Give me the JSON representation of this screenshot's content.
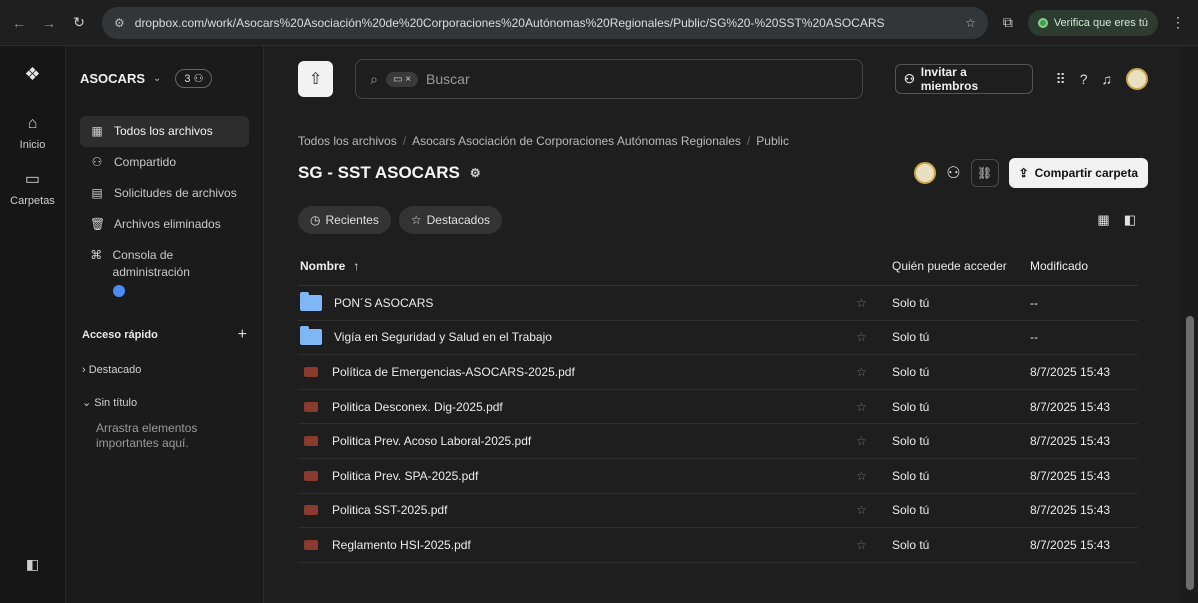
{
  "browser": {
    "url": "dropbox.com/work/Asocars%20Asociación%20de%20Corporaciones%20Autónomas%20Regionales/Public/SG%20-%20SST%20ASOCARS",
    "verify_label": "Verifica que eres tú"
  },
  "rail": {
    "items": [
      {
        "label": "Inicio"
      },
      {
        "label": "Carpetas"
      }
    ]
  },
  "sidebar": {
    "team_name": "ASOCARS",
    "member_count": "3",
    "nav": [
      {
        "label": "Todos los archivos"
      },
      {
        "label": "Compartido"
      },
      {
        "label": "Solicitudes de archivos"
      },
      {
        "label": "Archivos eliminados"
      },
      {
        "label": "Consola de administración"
      }
    ],
    "quick_access_title": "Acceso rápido",
    "quick_items": [
      "Destacado",
      "Sin título"
    ],
    "drag_hint": "Arrastra elementos importantes aquí."
  },
  "topbar": {
    "search_placeholder": "Buscar",
    "invite_label": "Invitar a miembros"
  },
  "breadcrumb": [
    "Todos los archivos",
    "Asocars Asociación de Corporaciones Autónomas Regionales",
    "Public"
  ],
  "folder": {
    "title": "SG - SST ASOCARS",
    "share_label": "Compartir carpeta"
  },
  "filters": {
    "recent": "Recientes",
    "starred": "Destacados"
  },
  "table": {
    "headers": {
      "name": "Nombre",
      "who": "Quién puede acceder",
      "modified": "Modificado"
    },
    "rows": [
      {
        "type": "folder",
        "name": "PON´S ASOCARS",
        "who": "Solo tú",
        "modified": "--"
      },
      {
        "type": "folder",
        "name": "Vigía en Seguridad y Salud en el Trabajo",
        "who": "Solo tú",
        "modified": "--"
      },
      {
        "type": "pdf",
        "name": "Política de Emergencias-ASOCARS-2025.pdf",
        "who": "Solo tú",
        "modified": "8/7/2025 15:43"
      },
      {
        "type": "pdf",
        "name": "Politica Desconex. Dig-2025.pdf",
        "who": "Solo tú",
        "modified": "8/7/2025 15:43"
      },
      {
        "type": "pdf",
        "name": "Politica Prev. Acoso Laboral-2025.pdf",
        "who": "Solo tú",
        "modified": "8/7/2025 15:43"
      },
      {
        "type": "pdf",
        "name": "Politica Prev. SPA-2025.pdf",
        "who": "Solo tú",
        "modified": "8/7/2025 15:43"
      },
      {
        "type": "pdf",
        "name": "Politica SST-2025.pdf",
        "who": "Solo tú",
        "modified": "8/7/2025 15:43"
      },
      {
        "type": "pdf",
        "name": "Reglamento HSI-2025.pdf",
        "who": "Solo tú",
        "modified": "8/7/2025 15:43"
      }
    ]
  }
}
